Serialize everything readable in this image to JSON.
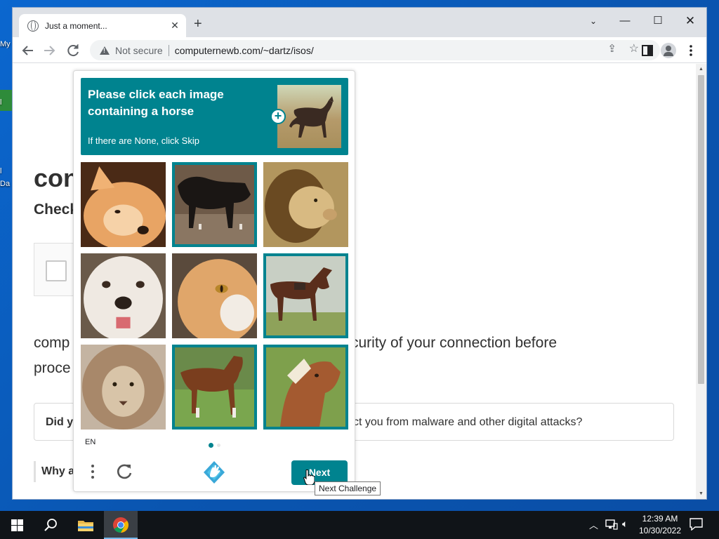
{
  "desktop": {
    "icon_labels": [
      "My",
      "",
      "l",
      "l",
      "Da"
    ]
  },
  "browser": {
    "tab_title": "Just a moment...",
    "tab_close": "✕",
    "new_tab": "+",
    "window_controls": {
      "tab_search": "⌄",
      "minimize": "—",
      "maximize": "☐",
      "close": "✕"
    },
    "security_label": "Not secure",
    "url": "computernewb.com/~dartz/isos/"
  },
  "page": {
    "heading": "con",
    "subheading": "Check",
    "para_start": "comp",
    "para_end": "curity of your connection before",
    "para_line2": "proce",
    "did_label": "Did y",
    "did_rest": "ct you from malware and other digital attacks?",
    "why_label": "Why a"
  },
  "captcha": {
    "prompt": "Please click each image containing a horse",
    "skip_hint": "If there are None, click Skip",
    "language": "EN",
    "next_label": "Next",
    "tooltip": "Next Challenge",
    "tiles": [
      {
        "subject": "dog",
        "selected": false
      },
      {
        "subject": "horse",
        "selected": true
      },
      {
        "subject": "lion",
        "selected": false
      },
      {
        "subject": "dog",
        "selected": false
      },
      {
        "subject": "cat",
        "selected": false
      },
      {
        "subject": "horse",
        "selected": true
      },
      {
        "subject": "lion",
        "selected": false
      },
      {
        "subject": "horse",
        "selected": true
      },
      {
        "subject": "horse",
        "selected": true
      }
    ],
    "accent_color": "#00838f"
  },
  "taskbar": {
    "time": "12:39 AM",
    "date": "10/30/2022",
    "icons": [
      "start-icon",
      "search-icon",
      "file-explorer-icon",
      "chrome-icon",
      "network-icon",
      "volume-icon",
      "notifications-icon"
    ]
  }
}
